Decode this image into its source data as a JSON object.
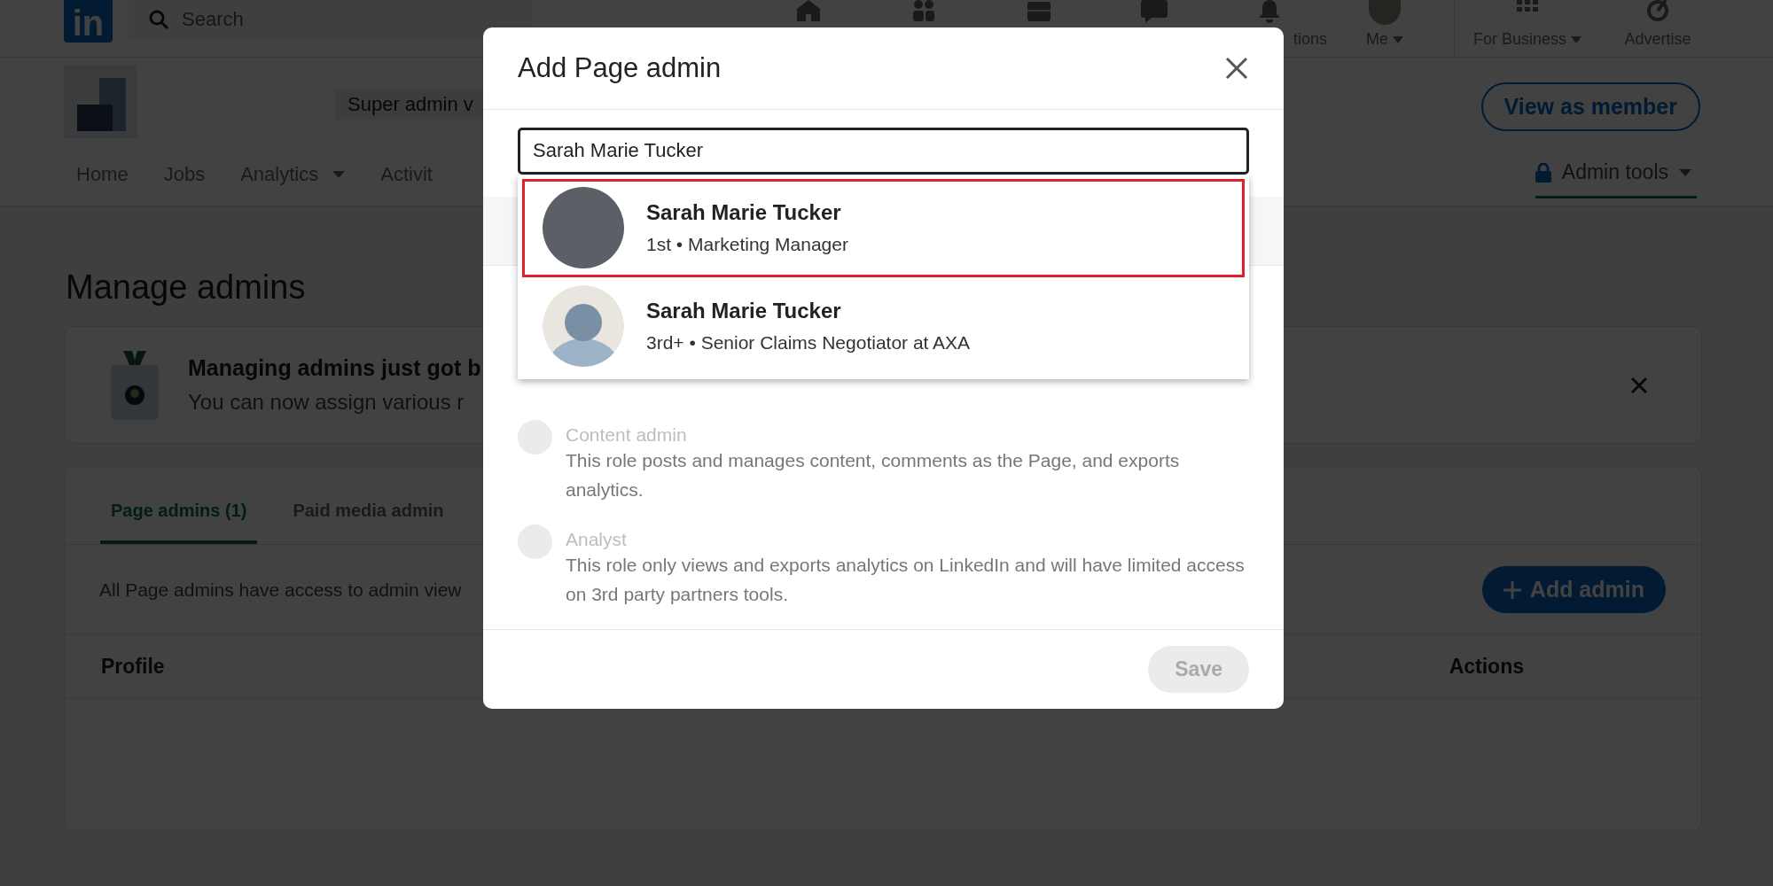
{
  "top_nav": {
    "logo": "in",
    "search": {
      "placeholder": "Search"
    },
    "items": [
      {
        "kind": "home"
      },
      {
        "kind": "network"
      },
      {
        "kind": "jobs"
      },
      {
        "kind": "messaging"
      },
      {
        "kind": "notifications",
        "label": "tions"
      },
      {
        "kind": "me",
        "label": "Me",
        "dropdown": true
      },
      {
        "kind": "business",
        "label": "For Business",
        "dropdown": true
      },
      {
        "kind": "advertise",
        "label": "Advertise"
      }
    ]
  },
  "page_header": {
    "role_chip": "Super admin v",
    "view_button": "View as member",
    "tabs": [
      {
        "label": "Home",
        "dropdown": false
      },
      {
        "label": "Jobs",
        "dropdown": false
      },
      {
        "label": "Analytics",
        "dropdown": true
      },
      {
        "label": "Activit",
        "dropdown": false
      }
    ],
    "admin_tools": {
      "label": "Admin tools",
      "selected": true
    }
  },
  "heading": "Manage admins",
  "banner": {
    "title": "Managing admins just got b",
    "text": "You can now assign various r"
  },
  "admins_card": {
    "tabs": [
      {
        "label": "Page admins (1)",
        "selected": true
      },
      {
        "label": "Paid media admin",
        "selected": false
      }
    ],
    "info": "All Page admins have access to admin view",
    "add_button": "Add admin",
    "columns": [
      "Profile",
      "Actions"
    ]
  },
  "modal": {
    "title": "Add Page admin",
    "search_value": "Sarah Marie Tucker",
    "results": [
      {
        "name": "Sarah Marie Tucker",
        "subtitle": "1st • Marketing Manager",
        "kind": "photo",
        "selected": true
      },
      {
        "name": "Sarah Marie Tucker",
        "subtitle": "3rd+ • Senior Claims Negotiator at AXA",
        "kind": "silhouette",
        "selected": false
      }
    ],
    "roles": [
      {
        "title": "Content admin",
        "description": "This role posts and manages content, comments as the Page, and exports analytics.",
        "selected": false,
        "disabled": true
      },
      {
        "title": "Analyst",
        "description": "This role only views and exports analytics on LinkedIn and will have limited access on 3rd party partners tools.",
        "selected": false,
        "disabled": true
      }
    ],
    "save": {
      "label": "Save",
      "disabled": true
    }
  }
}
